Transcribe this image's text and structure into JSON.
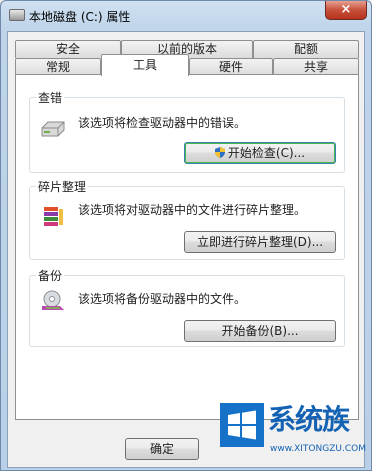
{
  "window": {
    "title": "本地磁盘 (C:) 属性",
    "close_glyph": "×"
  },
  "tabs_row1": [
    "安全",
    "以前的版本",
    "配额"
  ],
  "tabs_row2": [
    "常规",
    "工具",
    "硬件",
    "共享"
  ],
  "active_tab": "工具",
  "groups": {
    "check": {
      "title": "查错",
      "desc": "该选项将检查驱动器中的错误。",
      "button": "开始检查(C)..."
    },
    "defrag": {
      "title": "碎片整理",
      "desc": "该选项将对驱动器中的文件进行碎片整理。",
      "button": "立即进行碎片整理(D)..."
    },
    "backup": {
      "title": "备份",
      "desc": "该选项将备份驱动器中的文件。",
      "button": "开始备份(B)..."
    }
  },
  "footer": {
    "ok": "确定"
  },
  "watermark": {
    "brand": "系统族",
    "url": "www.XITONGZU.COM"
  }
}
